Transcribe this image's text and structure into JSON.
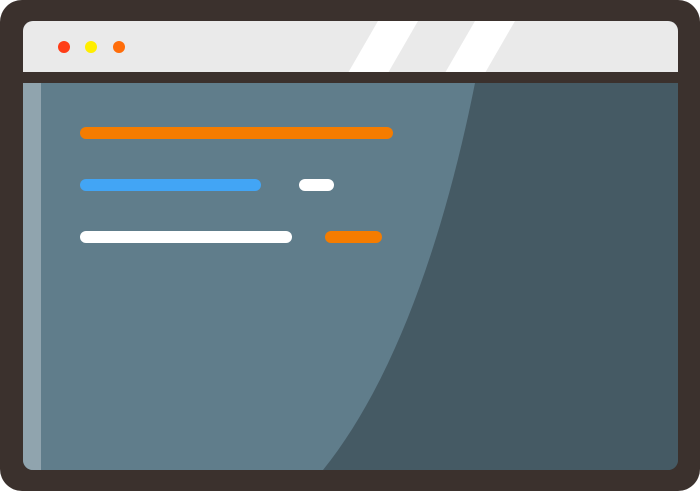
{
  "colors": {
    "frame": "#3b312d",
    "titlebar": "#eaeaea",
    "titlebar_stripe": "#ffffff",
    "content_dark": "#455a64",
    "content_light": "#607d8b",
    "side_strip": "#90a4ae"
  },
  "window_controls": [
    {
      "name": "close",
      "color": "#ff3d17"
    },
    {
      "name": "minimize",
      "color": "#ffee00"
    },
    {
      "name": "maximize",
      "color": "#ff6d0a"
    }
  ],
  "content_lines": [
    {
      "name": "heading-line",
      "color": "#f57c00"
    },
    {
      "name": "line-blue",
      "color": "#42a5f5"
    },
    {
      "name": "line-white-short",
      "color": "#ffffff"
    },
    {
      "name": "line-white-long",
      "color": "#ffffff"
    },
    {
      "name": "line-orange-short",
      "color": "#f57c00"
    }
  ]
}
